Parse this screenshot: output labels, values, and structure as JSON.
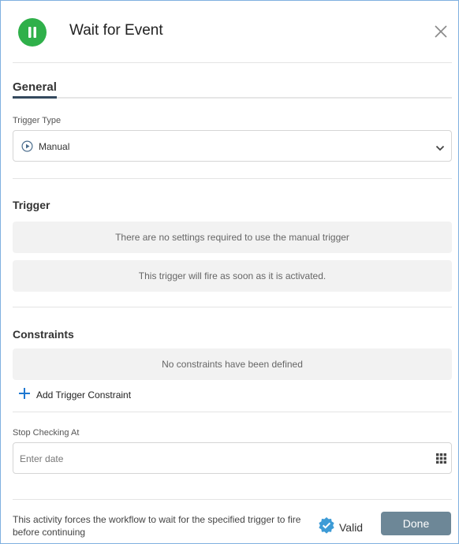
{
  "dialog": {
    "title": "Wait for Event",
    "status_color": "#2fb04a"
  },
  "tabs": [
    {
      "label": "General",
      "active": true
    }
  ],
  "trigger_type": {
    "label": "Trigger Type",
    "value": "Manual",
    "icon": "play-circle-icon"
  },
  "trigger": {
    "title": "Trigger",
    "messages": [
      "There are no settings required to use the manual trigger",
      "This trigger will fire as soon as it is activated."
    ]
  },
  "constraints": {
    "title": "Constraints",
    "empty_message": "No constraints have been defined",
    "add_label": "Add Trigger Constraint"
  },
  "stop_checking": {
    "label": "Stop Checking At",
    "placeholder": "Enter date"
  },
  "footer": {
    "description": "This activity forces the workflow to wait for the specified trigger to fire before continuing",
    "valid_label": "Valid",
    "done_label": "Done",
    "accent_color": "#6d8797",
    "valid_color": "#3d9bd6"
  }
}
